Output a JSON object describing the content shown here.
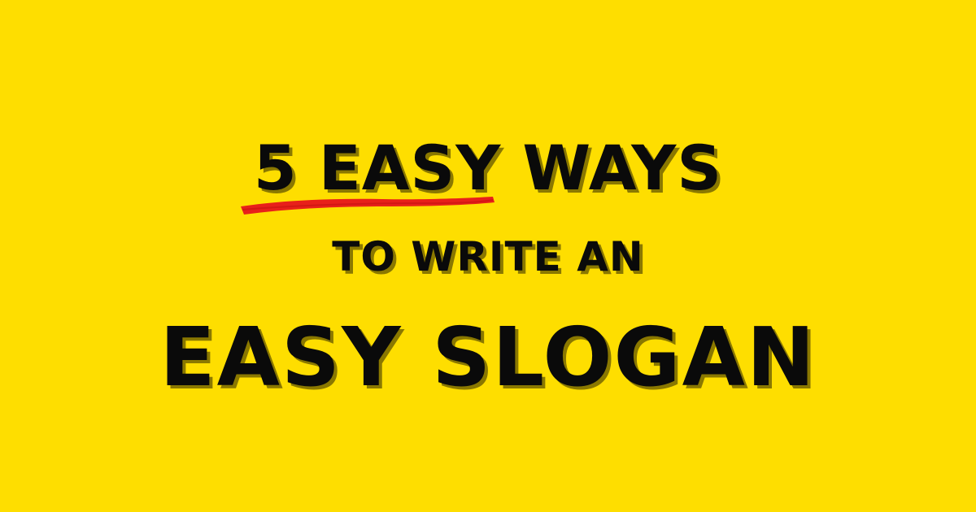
{
  "headline": {
    "line1": {
      "number": "5",
      "emphasis": "EASY",
      "rest": "WAYS"
    },
    "line2": "TO WRITE AN",
    "line3": "EASY SLOGAN"
  },
  "colors": {
    "background": "#FEDE00",
    "text": "#0A0A0A",
    "shadow": "#8A7800",
    "underline": "#E8201A"
  }
}
